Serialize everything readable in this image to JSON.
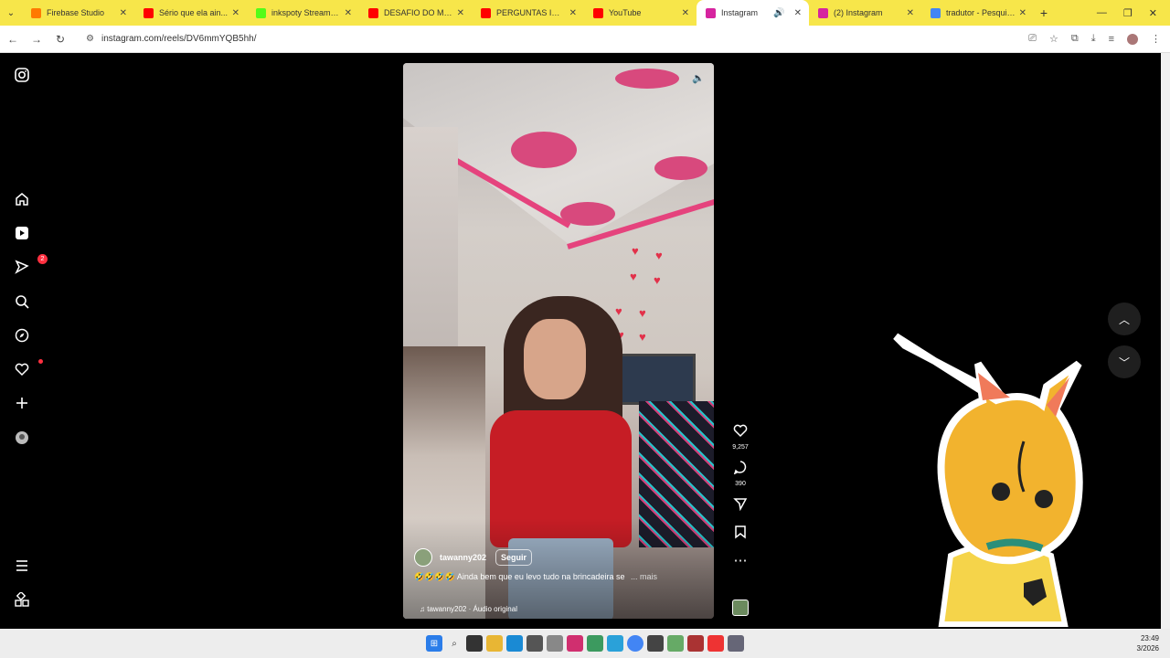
{
  "browser": {
    "tabs": [
      {
        "title": "Firebase Studio",
        "color": "#ff7a00"
      },
      {
        "title": "Sério que ela ain...",
        "color": "#ff0000"
      },
      {
        "title": "inkspoty Stream - W...",
        "color": "#53fc18"
      },
      {
        "title": "DESAFIO DO MANIC...",
        "color": "#ff0000"
      },
      {
        "title": "PERGUNTAS IDIOTAS...",
        "color": "#ff0000"
      },
      {
        "title": "YouTube",
        "color": "#ff0000"
      },
      {
        "title": "Instagram",
        "color": "#d6249f",
        "active": true
      },
      {
        "title": "(2) Instagram",
        "color": "#d6249f"
      },
      {
        "title": "tradutor - Pesquisa G...",
        "color": "#4285f4"
      }
    ],
    "url": "instagram.com/reels/DV6mmYQB5hh/"
  },
  "sidebar": {
    "notifications_badge": "2"
  },
  "reel": {
    "username": "tawanny202",
    "follow_label": "Seguir",
    "caption": "🤣🤣🤣🤣 Ainda bem que eu levo tudo na brincadeira se",
    "more_label": "... mais",
    "audio": "tawanny202 · Áudio original",
    "likes": "9,257",
    "comments": "390"
  },
  "taskbar": {
    "time": "23:49",
    "date": "3/2026"
  },
  "colors": {
    "tab_bar": "#f7e64a",
    "page_bg": "#000000",
    "badge": "#ff3040"
  }
}
